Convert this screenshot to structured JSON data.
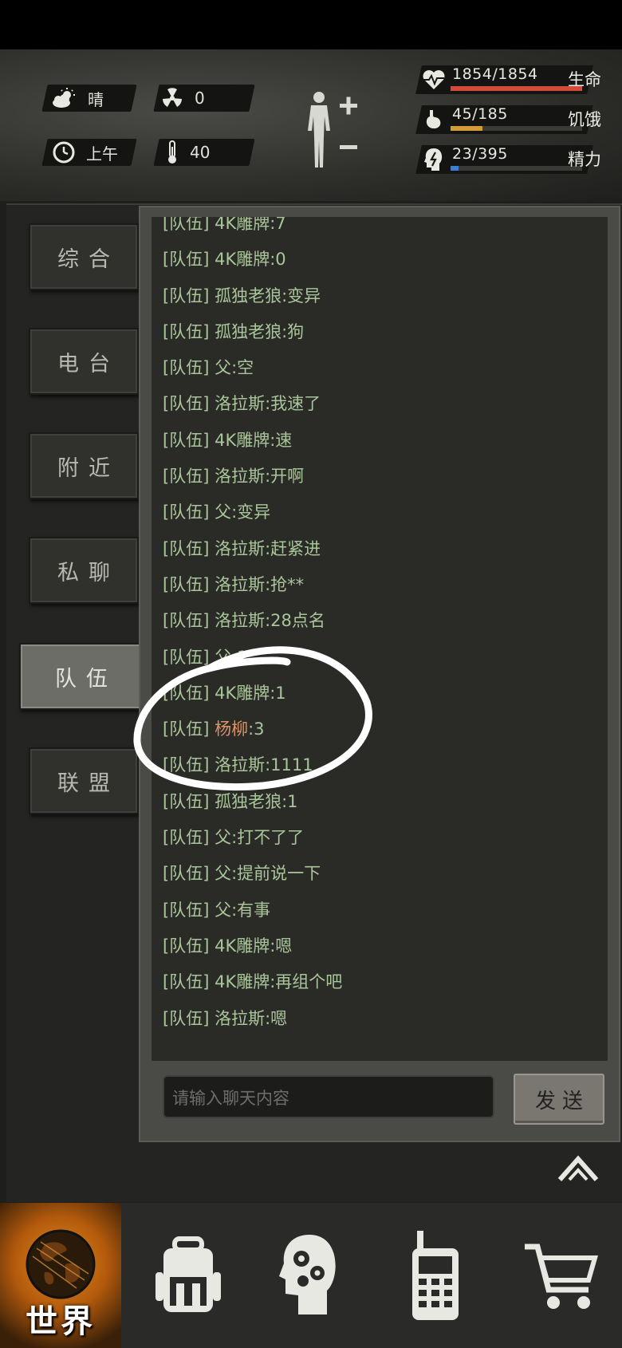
{
  "hud": {
    "weather_label": "晴",
    "radiation_value": "0",
    "time_label": "上午",
    "temperature_value": "40",
    "stats": [
      {
        "value": "1854/1854",
        "label": "生命",
        "fill": 1.0,
        "color": "#d24a3a",
        "icon": "heart-pulse-icon"
      },
      {
        "value": "45/185",
        "label": "饥饿",
        "fill": 0.24,
        "color": "#d39a3a",
        "icon": "stomach-icon"
      },
      {
        "value": "23/395",
        "label": "精力",
        "fill": 0.06,
        "color": "#3a7fd2",
        "icon": "energy-head-icon"
      }
    ]
  },
  "tabs": [
    {
      "label": "综合",
      "active": false
    },
    {
      "label": "电台",
      "active": false
    },
    {
      "label": "附近",
      "active": false
    },
    {
      "label": "私聊",
      "active": false
    },
    {
      "label": "队伍",
      "active": true
    },
    {
      "label": "联盟",
      "active": false
    }
  ],
  "chat": {
    "messages": [
      {
        "channel": "[队伍]",
        "sender": "4K雕牌",
        "text": ":7",
        "highlight": false
      },
      {
        "channel": "[队伍]",
        "sender": "4K雕牌",
        "text": ":0",
        "highlight": false
      },
      {
        "channel": "[队伍]",
        "sender": "孤独老狼",
        "text": ":变异",
        "highlight": false
      },
      {
        "channel": "[队伍]",
        "sender": "孤独老狼",
        "text": ":狗",
        "highlight": false
      },
      {
        "channel": "[队伍]",
        "sender": "父",
        "text": ":空",
        "highlight": false
      },
      {
        "channel": "[队伍]",
        "sender": "洛拉斯",
        "text": ":我速了",
        "highlight": false
      },
      {
        "channel": "[队伍]",
        "sender": "4K雕牌",
        "text": ":速",
        "highlight": false
      },
      {
        "channel": "[队伍]",
        "sender": "洛拉斯",
        "text": ":开啊",
        "highlight": false
      },
      {
        "channel": "[队伍]",
        "sender": "父",
        "text": ":变异",
        "highlight": false
      },
      {
        "channel": "[队伍]",
        "sender": "洛拉斯",
        "text": ":赶紧进",
        "highlight": false
      },
      {
        "channel": "[队伍]",
        "sender": "洛拉斯",
        "text": ":抢**",
        "highlight": false
      },
      {
        "channel": "[队伍]",
        "sender": "洛拉斯",
        "text": ":28点名",
        "highlight": false
      },
      {
        "channel": "[队伍]",
        "sender": "父",
        "text": ":1",
        "highlight": false
      },
      {
        "channel": "[队伍]",
        "sender": "4K雕牌",
        "text": ":1",
        "highlight": false
      },
      {
        "channel": "[队伍]",
        "sender": "杨柳",
        "text": ":3",
        "highlight": true
      },
      {
        "channel": "[队伍]",
        "sender": "洛拉斯",
        "text": ":1111",
        "highlight": false
      },
      {
        "channel": "[队伍]",
        "sender": "孤独老狼",
        "text": ":1",
        "highlight": false
      },
      {
        "channel": "[队伍]",
        "sender": "父",
        "text": ":打不了了",
        "highlight": false
      },
      {
        "channel": "[队伍]",
        "sender": "父",
        "text": ":提前说一下",
        "highlight": false
      },
      {
        "channel": "[队伍]",
        "sender": "父",
        "text": ":有事",
        "highlight": false
      },
      {
        "channel": "[队伍]",
        "sender": "4K雕牌",
        "text": ":嗯",
        "highlight": false
      },
      {
        "channel": "[队伍]",
        "sender": "4K雕牌",
        "text": ":再组个吧",
        "highlight": false
      },
      {
        "channel": "[队伍]",
        "sender": "洛拉斯",
        "text": ":嗯",
        "highlight": false
      }
    ],
    "input_placeholder": "请输入聊天内容",
    "send_label": "发送"
  },
  "nav": {
    "world_label": "世界",
    "items": [
      "world-globe-icon",
      "backpack-icon",
      "skills-head-icon",
      "walkie-talkie-icon",
      "shopping-cart-icon"
    ]
  }
}
